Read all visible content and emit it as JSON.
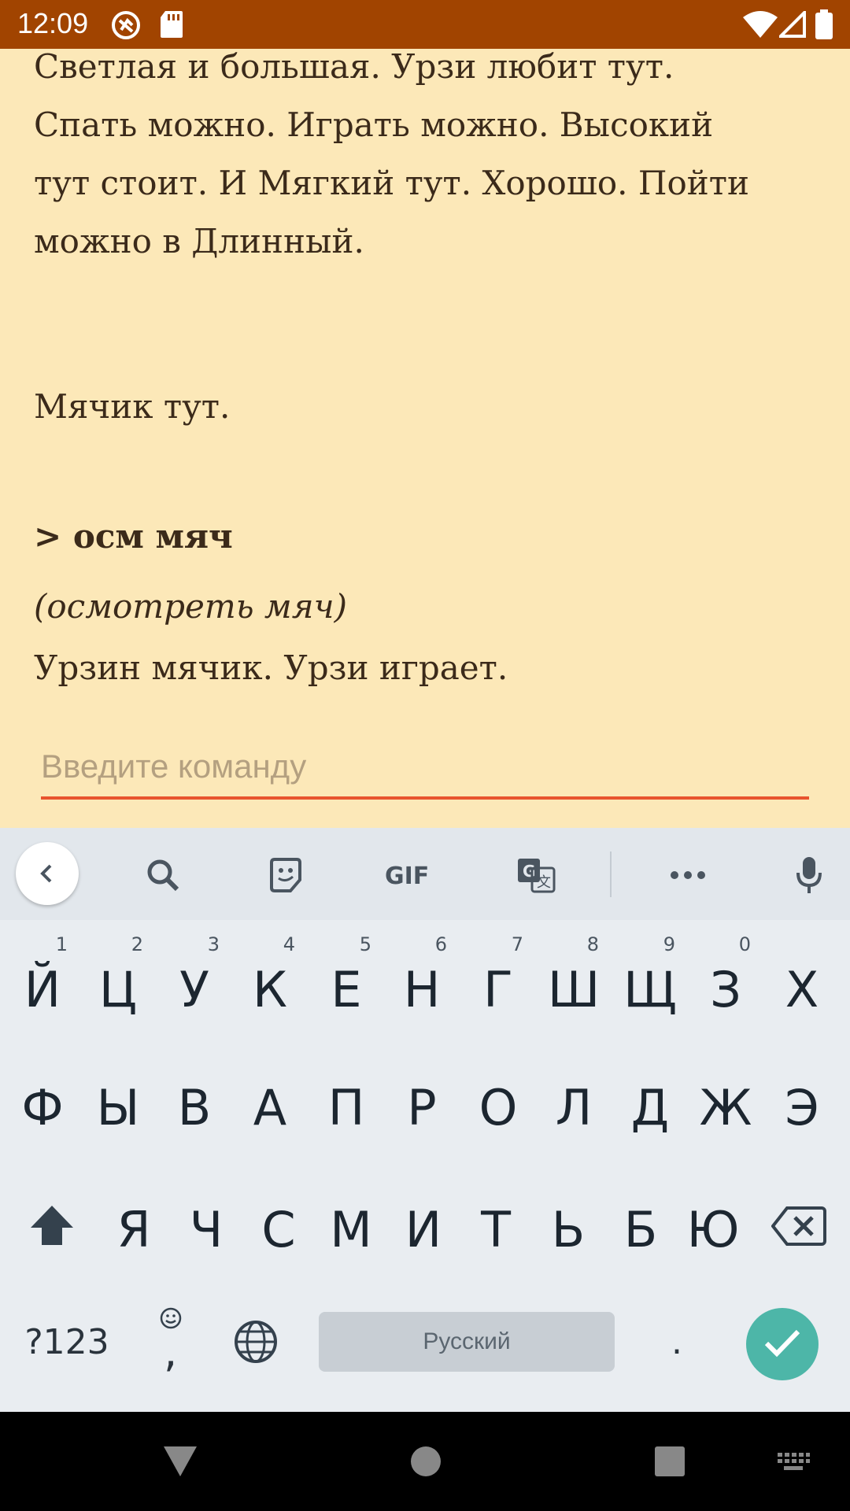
{
  "status_bar": {
    "time": "12:09"
  },
  "story": {
    "paragraphs": [
      "Светлая и большая. Урзи любит тут.\nСпать можно. Играть можно. Высокий\nтут стоит. И Мягкий тут. Хорошо. Пойти\nможно в Длинный.",
      "Мячик тут.",
      "> осм мяч",
      "(осмотреть мяч)",
      "Урзин мячик. Урзи играет."
    ]
  },
  "command_input": {
    "placeholder": "Введите команду",
    "value": ""
  },
  "keyboard": {
    "toolbar_icons": [
      "chevron-left-icon",
      "search-icon",
      "sticker-icon",
      "gif-icon",
      "translate-icon",
      "more-icon",
      "mic-icon"
    ],
    "row1": [
      "Й",
      "Ц",
      "У",
      "К",
      "Е",
      "Н",
      "Г",
      "Ш",
      "Щ",
      "З",
      "Х"
    ],
    "row1_hints": [
      "1",
      "2",
      "3",
      "4",
      "5",
      "6",
      "7",
      "8",
      "9",
      "0",
      ""
    ],
    "row2": [
      "Ф",
      "Ы",
      "В",
      "А",
      "П",
      "Р",
      "О",
      "Л",
      "Д",
      "Ж",
      "Э"
    ],
    "row3": [
      "Я",
      "Ч",
      "С",
      "М",
      "И",
      "Т",
      "Ь",
      "Б",
      "Ю"
    ],
    "symbols_label": "?123",
    "comma_label": ",",
    "period_label": ".",
    "space_label": "Русский",
    "accent_color": "#4db6a8"
  },
  "colors": {
    "status_bar": "#a14400",
    "background": "#fce8b8",
    "input_underline": "#e8542e"
  }
}
